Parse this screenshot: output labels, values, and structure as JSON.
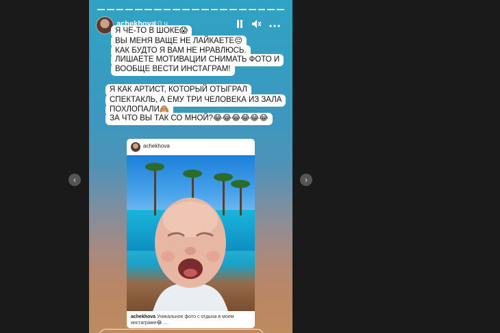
{
  "story": {
    "username": "achekhova",
    "time": "10 ч",
    "icons": {
      "pause": "pause-icon",
      "mute": "mute-icon",
      "more": "more-icon"
    },
    "messages": [
      "Я ЧЕ-ТО В ШОКЕ😱",
      "ВЫ МЕНЯ ВАЩЕ НЕ ЛАЙКАЕТЕ😔",
      "КАК БУДТО Я ВАМ НЕ НРАВЛЮСЬ.",
      "ЛИШАЕТЕ МОТИВАЦИИ СНИМАТЬ ФОТО И",
      "ВООБЩЕ ВЕСТИ ИНСТАГРАМ!",
      "Я КАК АРТИСТ, КОТОРЫЙ ОТЫГРАЛ",
      "СПЕКТАКЛЬ, А ЕМУ ТРИ ЧЕЛОВЕКА ИЗ ЗАЛА",
      "ПОХЛОПАЛИ🙈",
      "ЗА ЧТО ВЫ ТАК СО МНОЙ?😂😂😂😂😂😂"
    ]
  },
  "post": {
    "username": "achekhova",
    "caption_user": "achekhova",
    "caption_text": "Уникальное фото с отдыха в моем инстаграме😂 ..."
  },
  "nav": {
    "prev": "‹",
    "next": "›"
  },
  "colors": {
    "bubble": "#ffffff",
    "story_top": "#2fa3c4",
    "story_bottom": "#be8a60"
  }
}
